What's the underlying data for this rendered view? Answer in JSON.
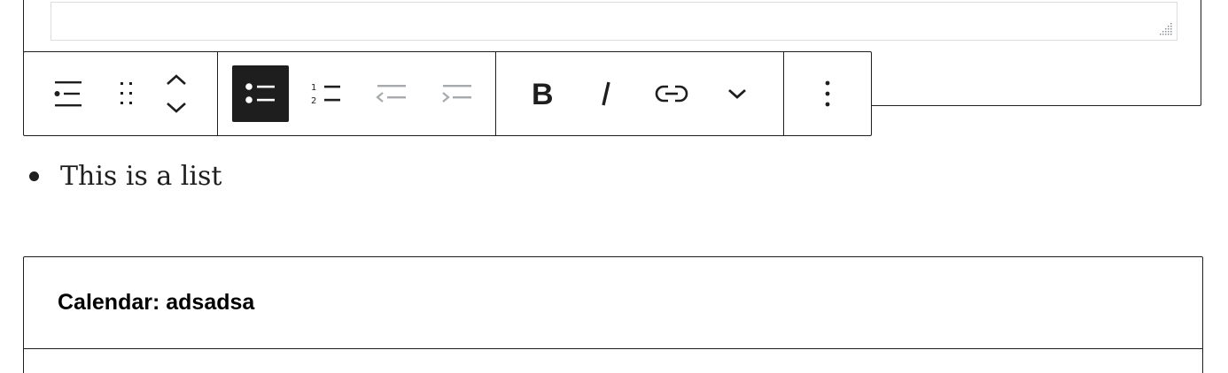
{
  "toolbar": {
    "groups": [
      {
        "name": "block-tools",
        "items": [
          "list-block-icon",
          "drag-handle-icon",
          "move-up-icon",
          "move-down-icon"
        ]
      },
      {
        "name": "list-tools",
        "items": [
          "unordered-list-icon",
          "ordered-list-icon",
          "outdent-icon",
          "indent-icon"
        ]
      },
      {
        "name": "format-tools",
        "items": [
          "bold-icon",
          "italic-icon",
          "link-icon",
          "chevron-down-icon"
        ]
      },
      {
        "name": "options",
        "items": [
          "more-vertical-icon"
        ]
      }
    ],
    "active_item": "unordered-list-icon",
    "colors": {
      "icon": "#1e1e1e",
      "disabled": "#a7aaad",
      "active_bg": "#1e1e1e",
      "active_fg": "#ffffff"
    }
  },
  "list": {
    "items": [
      "This is a list"
    ]
  },
  "calendar": {
    "title": "Calendar: adsadsa"
  }
}
